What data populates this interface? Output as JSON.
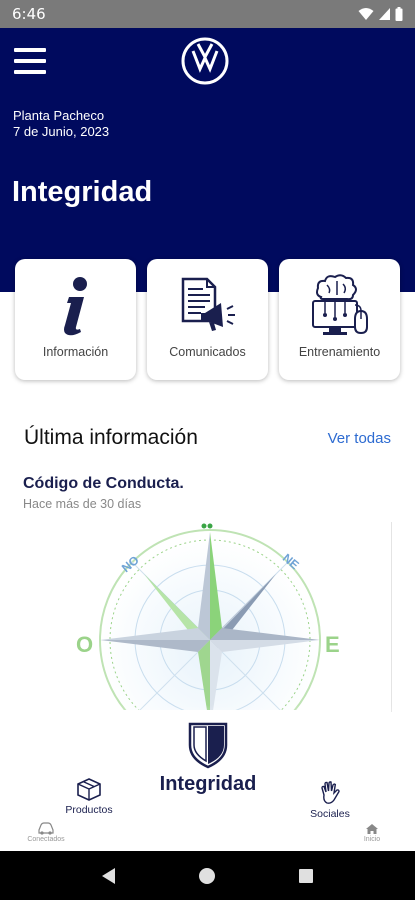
{
  "status_bar": {
    "time": "6:46"
  },
  "header": {
    "plant": "Planta Pacheco",
    "date": "7 de Junio, 2023",
    "title": "Integridad"
  },
  "cards": [
    {
      "label": "Información",
      "icon": "info-icon"
    },
    {
      "label": "Comunicados",
      "icon": "megaphone-document-icon"
    },
    {
      "label": "Entrenamiento",
      "icon": "training-computer-icon"
    }
  ],
  "latest": {
    "title": "Última información",
    "view_all": "Ver todas",
    "article": {
      "title": "Código de Conducta.",
      "subtitle": "Hace más de 30 días",
      "compass_labels": {
        "nw": "NO",
        "ne": "NE",
        "w": "O",
        "e": "E"
      }
    }
  },
  "bottom_nav": {
    "products": "Productos",
    "integrity": "Integridad",
    "socials": "Sociales",
    "connected": "Conectados",
    "home": "Inicio"
  },
  "colors": {
    "header_bg": "#000a5e",
    "accent_blue": "#2d6bd1",
    "navy_text": "#1a1f4e",
    "compass_green": "#8bd37a"
  }
}
